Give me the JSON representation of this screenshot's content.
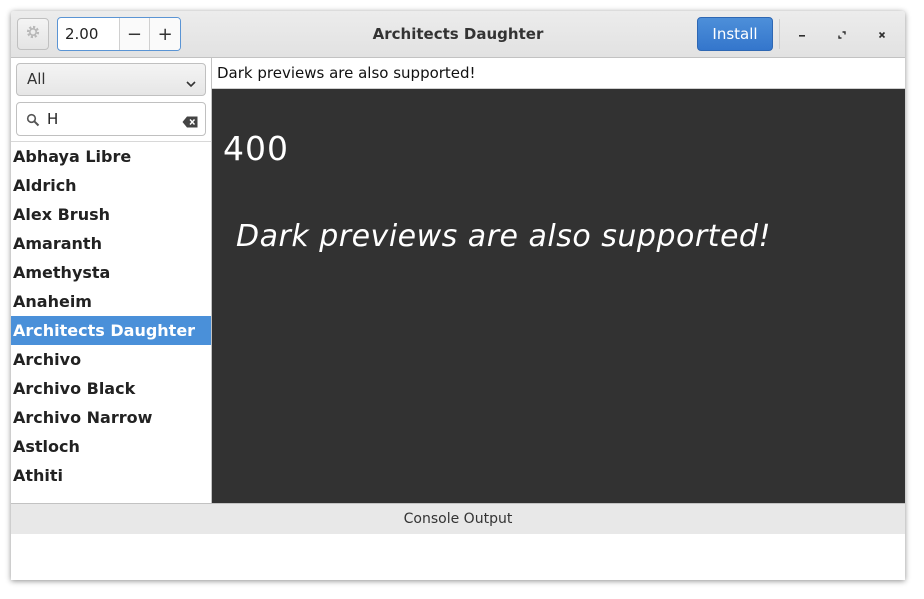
{
  "window": {
    "title": "Architects Daughter"
  },
  "header": {
    "settings_icon": "gear-icon",
    "size_value": "2.00",
    "decrement_label": "−",
    "increment_label": "+",
    "install_label": "Install",
    "minimize_icon": "minimize-icon",
    "maximize_icon": "maximize-icon",
    "close_icon": "close-icon",
    "accent_color": "#3b82d2"
  },
  "sidebar": {
    "filter_selected": "All",
    "search_value": "H",
    "fonts": [
      "Abhaya Libre",
      "Aldrich",
      "Alex Brush",
      "Amaranth",
      "Amethysta",
      "Anaheim",
      "Architects Daughter",
      "Archivo",
      "Archivo Black",
      "Archivo Narrow",
      "Astloch",
      "Athiti"
    ],
    "selected_font": "Architects Daughter",
    "selection_color": "#4a90d9"
  },
  "preview": {
    "sample_text_entry": "Dark previews are also supported!",
    "weight_label": "400",
    "sample_text": "Dark previews are also supported!",
    "background_color": "#323232"
  },
  "console": {
    "header_label": "Console Output"
  }
}
